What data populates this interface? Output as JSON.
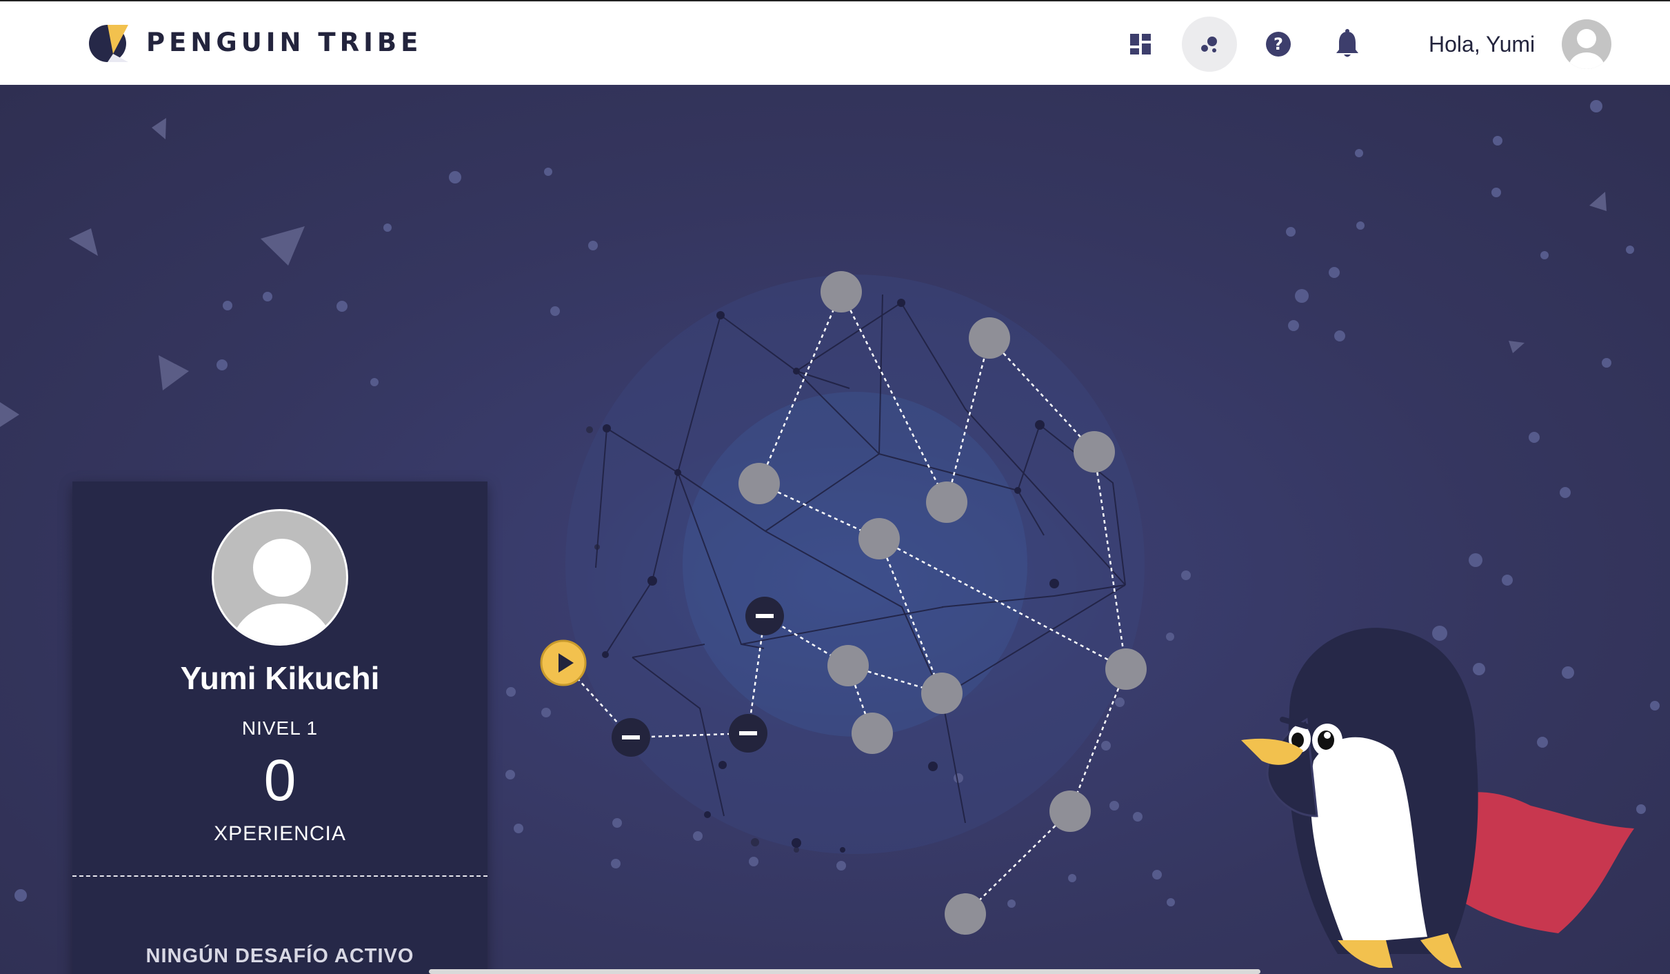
{
  "header": {
    "brand": "PENGUIN TRIBE",
    "greeting": "Hola, Yumi",
    "icons": [
      "dashboard-icon",
      "constellation-icon",
      "help-icon",
      "bell-icon"
    ],
    "active_icon": "constellation-icon"
  },
  "profile": {
    "name": "Yumi Kikuchi",
    "level": "NIVEL 1",
    "xp": "0",
    "xp_label": "XPERIENCIA",
    "challenge": "NINGÚN DESAFÍO ACTIVO"
  },
  "colors": {
    "background": "#35365f",
    "card": "#262848",
    "node_locked": "#8f8f97",
    "node_done": "#23243d",
    "node_start": "#f2c14e",
    "header_icon": "#3d3e6c"
  }
}
